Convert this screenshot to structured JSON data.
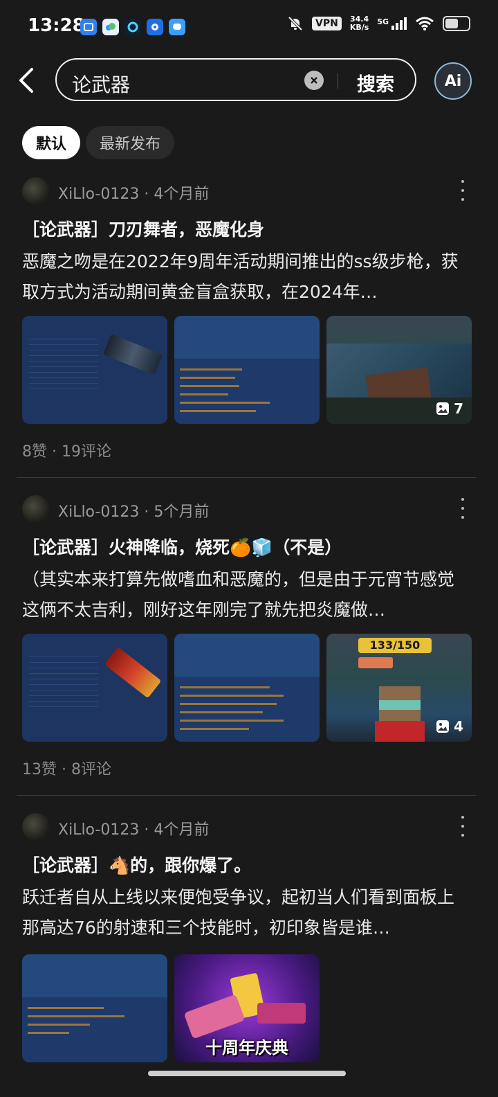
{
  "status_bar": {
    "time": "13:28",
    "vpn": "VPN",
    "speed_value": "34.4",
    "speed_unit": "KB/s",
    "network": "5G"
  },
  "header": {
    "search_value": "论武器",
    "search_button": "搜索",
    "ai_label": "Ai"
  },
  "tabs": [
    {
      "label": "默认",
      "active": true
    },
    {
      "label": "最新发布",
      "active": false
    }
  ],
  "posts": [
    {
      "author": "XiLlo-0123",
      "time": "4个月前",
      "title": "［论武器］刀刃舞者，恶魔化身",
      "body": "恶魔之吻是在2022年9周年活动期间推出的ss级步枪，获取方式为活动期间黄金盲盒获取，在2024年…",
      "image_count": "7",
      "likes": "8赞",
      "comments": "19评论"
    },
    {
      "author": "XiLlo-0123",
      "time": "5个月前",
      "title": "［论武器］火神降临，烧死🍊🧊（不是）",
      "body": "（其实本来打算先做嗜血和恶魔的，但是由于元宵节感觉这俩不太吉利，刚好这年刚完了就先把炎魔做…",
      "image_count": "4",
      "hud_text": "133/150",
      "likes": "13赞",
      "comments": "8评论"
    },
    {
      "author": "XiLlo-0123",
      "time": "4个月前",
      "title": "［论武器］🐴的，跟你爆了。",
      "body": "跃迁者自从上线以来便饱受争议，起初当人们看到面板上那高达76的射速和三个技能时，初印象皆是谁…",
      "promo_text": "十周年庆典"
    }
  ],
  "colors": {
    "background": "#1a1a1a",
    "muted_text": "#9a9a9a",
    "thumb_blue": "#1d3560"
  }
}
